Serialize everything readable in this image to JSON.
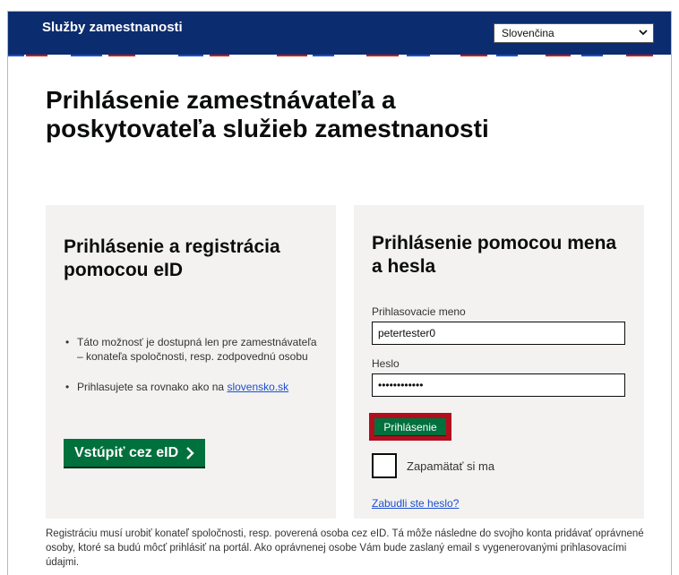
{
  "header": {
    "brand": "Služby zamestnanosti",
    "language_value": "Slovenčina",
    "colors": {
      "background": "#0b2c6f",
      "stripe_red": "#d0190f",
      "stripe_blue": "#1d4fd0"
    }
  },
  "page": {
    "title": "Prihlásenie zamestnávateľa a poskytovateľa služieb zamestnanosti"
  },
  "eid_panel": {
    "heading": "Prihlásenie a registrácia pomocou eID",
    "bullet_1": "Táto možnosť je dostupná len pre zamestnávateľa – konateľa spoločnosti, resp. zodpovednú osobu",
    "bullet_2_text": "Prihlasujete sa rovnako ako na ",
    "bullet_2_link": "slovensko.sk",
    "button_label": "Vstúpiť cez eID",
    "button_icon": "chevron-right-icon"
  },
  "login_panel": {
    "heading": "Prihlásenie pomocou mena a hesla",
    "username_label": "Prihlasovacie meno",
    "username_value": "petertester0",
    "password_label": "Heslo",
    "password_value": "••••••••••••",
    "login_button": "Prihlásenie",
    "remember_label": "Zapamätať si ma",
    "forgot_link": "Zabudli ste heslo?",
    "colors": {
      "button": "#00703c",
      "highlight_outline": "#b10e1e"
    }
  },
  "footer": {
    "note": "Registráciu musí urobiť konateľ spoločnosti, resp. poverená osoba cez eID. Tá môže následne do svojho konta pridávať oprávnené osoby, ktoré sa budú môcť prihlásiť na portál. Ako oprávnenej osobe Vám bude zaslaný email s vygenerovanými prihlasovacími údajmi."
  }
}
